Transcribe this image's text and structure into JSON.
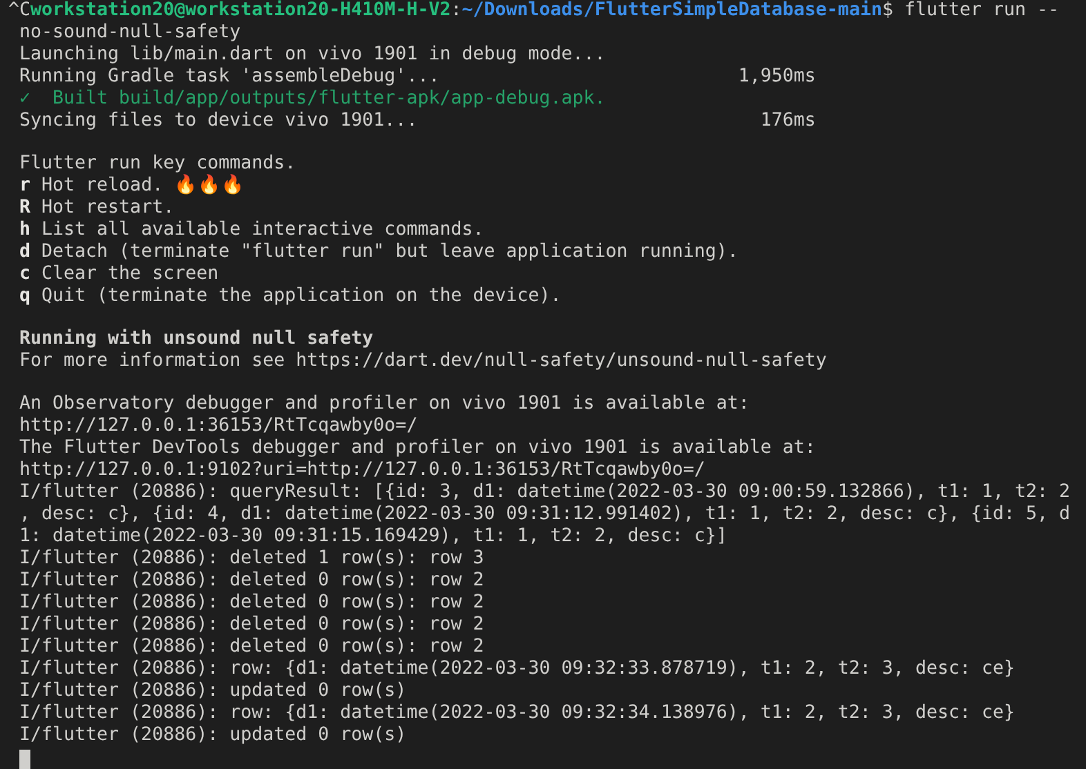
{
  "terminal": {
    "lines": [
      {
        "kind": "prompt",
        "prefix": "^C",
        "user_host": "workstation20@workstation20-H410M-H-V2",
        "separator": ":",
        "path": "~/Downloads/FlutterSimpleDatabase-main",
        "command": "$ flutter run --"
      },
      {
        "kind": "plain",
        "text": "no-sound-null-safety"
      },
      {
        "kind": "plain",
        "text": "Launching lib/main.dart on vivo 1901 in debug mode..."
      },
      {
        "kind": "plain",
        "text": "Running Gradle task 'assembleDebug'...                           1,950ms"
      },
      {
        "kind": "success",
        "text": "✓  Built build/app/outputs/flutter-apk/app-debug.apk."
      },
      {
        "kind": "plain",
        "text": "Syncing files to device vivo 1901...                               176ms"
      },
      {
        "kind": "blank"
      },
      {
        "kind": "plain",
        "text": "Flutter run key commands."
      },
      {
        "kind": "key",
        "key": "r",
        "text": "Hot reload. 🔥🔥🔥"
      },
      {
        "kind": "key",
        "key": "R",
        "text": "Hot restart."
      },
      {
        "kind": "key",
        "key": "h",
        "text": "List all available interactive commands."
      },
      {
        "kind": "key",
        "key": "d",
        "text": "Detach (terminate \"flutter run\" but leave application running)."
      },
      {
        "kind": "key",
        "key": "c",
        "text": "Clear the screen"
      },
      {
        "kind": "key",
        "key": "q",
        "text": "Quit (terminate the application on the device)."
      },
      {
        "kind": "blank"
      },
      {
        "kind": "heading",
        "text": "Running with unsound null safety"
      },
      {
        "kind": "plain",
        "text": "For more information see https://dart.dev/null-safety/unsound-null-safety"
      },
      {
        "kind": "blank"
      },
      {
        "kind": "plain",
        "text": "An Observatory debugger and profiler on vivo 1901 is available at:"
      },
      {
        "kind": "plain",
        "text": "http://127.0.0.1:36153/RtTcqawby0o=/"
      },
      {
        "kind": "plain",
        "text": "The Flutter DevTools debugger and profiler on vivo 1901 is available at:"
      },
      {
        "kind": "plain",
        "text": "http://127.0.0.1:9102?uri=http://127.0.0.1:36153/RtTcqawby0o=/"
      },
      {
        "kind": "plain",
        "text": "I/flutter (20886): queryResult: [{id: 3, d1: datetime(2022-03-30 09:00:59.132866), t1: 1, t2: 2"
      },
      {
        "kind": "plain",
        "text": ", desc: c}, {id: 4, d1: datetime(2022-03-30 09:31:12.991402), t1: 1, t2: 2, desc: c}, {id: 5, d"
      },
      {
        "kind": "plain",
        "text": "1: datetime(2022-03-30 09:31:15.169429), t1: 1, t2: 2, desc: c}]"
      },
      {
        "kind": "plain",
        "text": "I/flutter (20886): deleted 1 row(s): row 3"
      },
      {
        "kind": "plain",
        "text": "I/flutter (20886): deleted 0 row(s): row 2"
      },
      {
        "kind": "plain",
        "text": "I/flutter (20886): deleted 0 row(s): row 2"
      },
      {
        "kind": "plain",
        "text": "I/flutter (20886): deleted 0 row(s): row 2"
      },
      {
        "kind": "plain",
        "text": "I/flutter (20886): deleted 0 row(s): row 2"
      },
      {
        "kind": "plain",
        "text": "I/flutter (20886): row: {d1: datetime(2022-03-30 09:32:33.878719), t1: 2, t2: 3, desc: ce}"
      },
      {
        "kind": "plain",
        "text": "I/flutter (20886): updated 0 row(s)"
      },
      {
        "kind": "plain",
        "text": "I/flutter (20886): row: {d1: datetime(2022-03-30 09:32:34.138976), t1: 2, t2: 3, desc: ce}"
      },
      {
        "kind": "plain",
        "text": "I/flutter (20886): updated 0 row(s)"
      },
      {
        "kind": "cursor"
      }
    ]
  }
}
